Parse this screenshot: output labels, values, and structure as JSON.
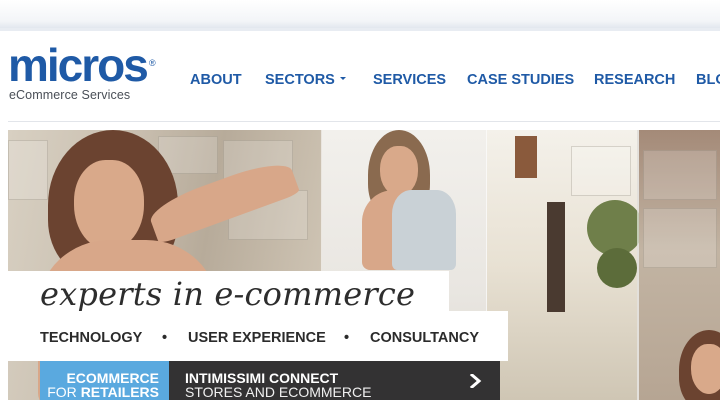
{
  "logo": {
    "wordmark": "micros",
    "registered": "®",
    "subtitle": "eCommerce  Services"
  },
  "nav": {
    "items": [
      {
        "label": "ABOUT"
      },
      {
        "label": "SECTORS",
        "has_dropdown": true
      },
      {
        "label": "SERVICES"
      },
      {
        "label": "CASE STUDIES"
      },
      {
        "label": "RESEARCH"
      },
      {
        "label": "BLO"
      }
    ]
  },
  "hero": {
    "tagline": "experts in e-commerce",
    "services": [
      "TECHNOLOGY",
      "USER EXPERIENCE",
      "CONSULTANCY"
    ],
    "separator": "•"
  },
  "promo": {
    "category_line1": "ECOMMERCE",
    "category_line2_prefix": "FOR",
    "category_line2_bold": "RETAILERS",
    "title": "INTIMISSIMI CONNECT",
    "subtitle": "STORES AND ECOMMERCE",
    "arrow_icon": "chevron-right-icon"
  },
  "colors": {
    "brand_blue": "#1f5aa6",
    "promo_blue": "#5aa9df",
    "promo_dark": "#333233"
  }
}
